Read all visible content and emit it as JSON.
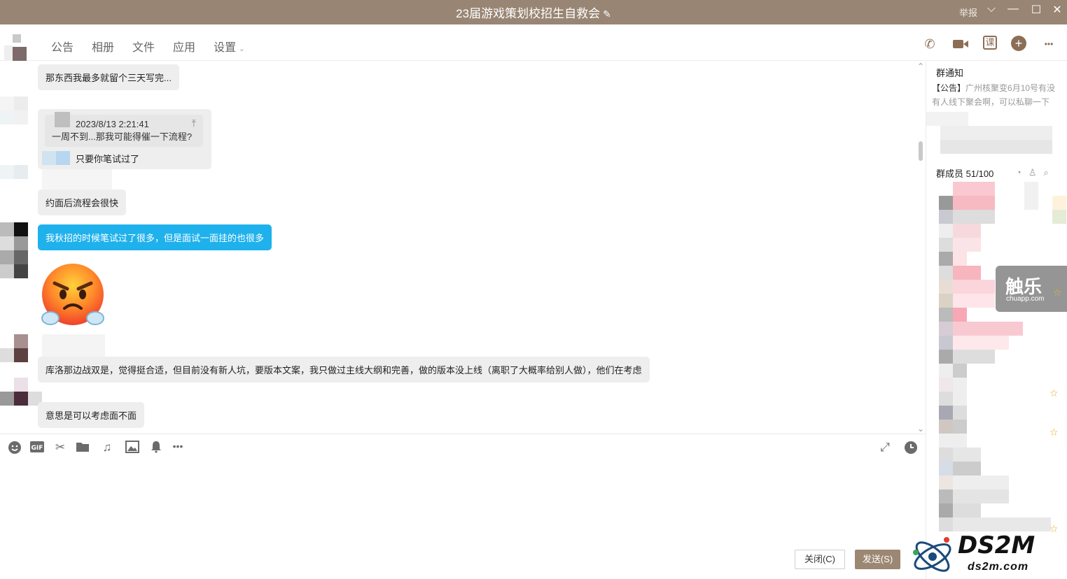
{
  "window": {
    "title": "23届游戏策划校招生自救会",
    "edit_icon": "✎",
    "report": "举报",
    "controls": {
      "dropdown": "⌵",
      "minimize": "—",
      "maximize": "☐",
      "close": "✕"
    }
  },
  "toolbar": {
    "tabs": [
      {
        "label": "公告"
      },
      {
        "label": "相册"
      },
      {
        "label": "文件"
      },
      {
        "label": "应用"
      },
      {
        "label": "设置"
      }
    ],
    "settings_caret": "⌄",
    "icons": {
      "call": "✆",
      "video": "■",
      "course": "课",
      "add": "+",
      "more": "•••"
    }
  },
  "messages": [
    {
      "text": "那东西我最多就留个三天写完..."
    },
    {
      "quote_time": "2023/8/13 2:21:41",
      "quote_text": "一周不到...那我可能得催一下流程?",
      "reply": "只要你笔试过了"
    },
    {
      "text": "约面后流程会很快"
    },
    {
      "text": "我秋招的时候笔试过了很多，但是面试一面挂的也很多"
    },
    {
      "text": "库洛那边战双是，觉得挺合适，但目前没有新人坑，要版本文案，我只做过主线大纲和完善，做的版本没上线（离职了大概率给别人做），他们在考虑"
    },
    {
      "text": "意思是可以考虑面不面"
    }
  ],
  "input": {
    "tools": [
      "emoji-icon",
      "gif-icon",
      "scissors-icon",
      "folder-icon",
      "music-icon",
      "image-icon",
      "bell-icon",
      "more-icon"
    ],
    "close_label": "关闭(C)",
    "send_label": "发送(S)"
  },
  "right_panel": {
    "notice_title": "群通知",
    "notice_tag": "【公告】",
    "notice_text": "广州核聚变6月10号有没有人线下聚会啊，可以私聊一下",
    "members_title": "群成员 51/100"
  },
  "watermarks": {
    "chuapp_main": "触乐",
    "chuapp_sub": "chuapp.com",
    "ds2m_main": "DS2M",
    "ds2m_sub": "ds2m.com"
  },
  "colors": {
    "titlebar": "#988573",
    "accent": "#8b6e55",
    "blue_bubble": "#1fb1ec",
    "bubble": "#eeeeee"
  }
}
